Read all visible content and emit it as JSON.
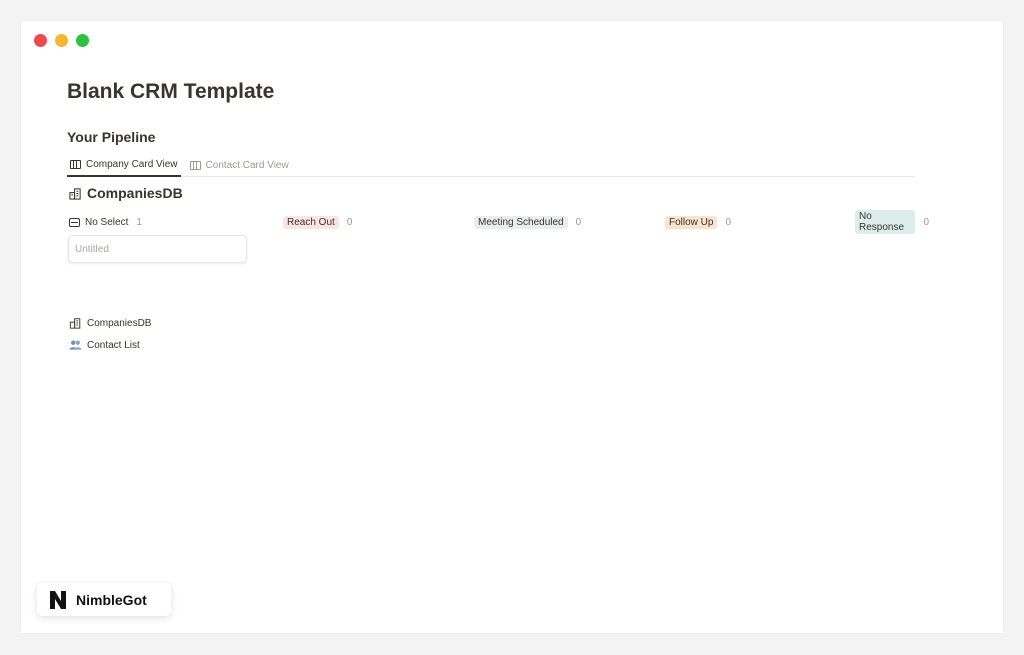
{
  "page": {
    "title": "Blank CRM Template",
    "section_title": "Your Pipeline"
  },
  "tabs": [
    {
      "label": "Company Card View",
      "active": true
    },
    {
      "label": "Contact Card View",
      "active": false
    }
  ],
  "database": {
    "title": "CompaniesDB",
    "icon": "building-icon"
  },
  "board": {
    "columns": [
      {
        "label": "No Select",
        "count": "1",
        "color": ""
      },
      {
        "label": "Reach Out",
        "count": "0",
        "color": "#fbe4e4"
      },
      {
        "label": "Meeting Scheduled",
        "count": "0",
        "color": "#ebeced"
      },
      {
        "label": "Follow Up",
        "count": "0",
        "color": "#fae3cf"
      },
      {
        "label": "No Response",
        "count": "0",
        "color": "#ddedea"
      }
    ],
    "card": {
      "placeholder": "Untitled"
    }
  },
  "links": [
    {
      "label": "CompaniesDB",
      "icon": "building-icon"
    },
    {
      "label": "Contact List",
      "icon": "people-icon"
    }
  ],
  "badge": {
    "text": "NimbleGot",
    "icon": "n-logo-icon"
  }
}
